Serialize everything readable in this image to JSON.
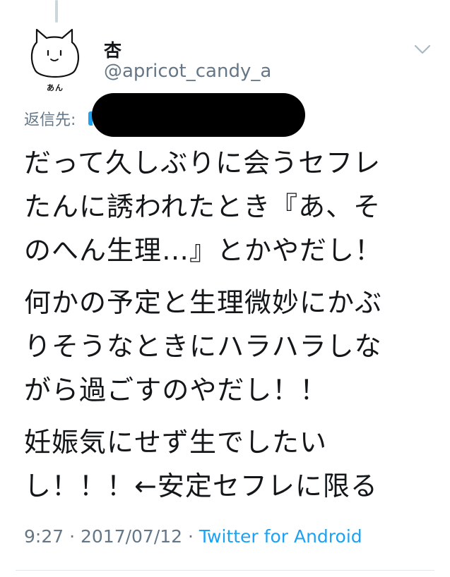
{
  "author": {
    "display_name": "杏",
    "handle": "@apricot_candy_a",
    "avatar_caption": "あん"
  },
  "reply": {
    "label": "返信先:"
  },
  "tweet": {
    "paragraphs": [
      [
        "だって久しぶりに会うセフレ",
        "たんに誘われたとき『あ、そ",
        "のへん生理…』とかやだし！"
      ],
      [
        "何かの予定と生理微妙にかぶ",
        "りそうなときにハラハラしな",
        "がら過ごすのやだし！！"
      ],
      [
        "妊娠気にせず生でしたい",
        "し！！！←安定セフレに限る"
      ]
    ]
  },
  "meta": {
    "time": "9:27",
    "separator": " · ",
    "date": "2017/07/12",
    "source": "Twitter for Android"
  },
  "colors": {
    "text": "#14171a",
    "muted": "#657786",
    "link": "#1da1f2",
    "redaction": "#000000"
  },
  "icons": {
    "avatar": "cat-avatar-icon",
    "menu": "chevron-down-icon"
  }
}
